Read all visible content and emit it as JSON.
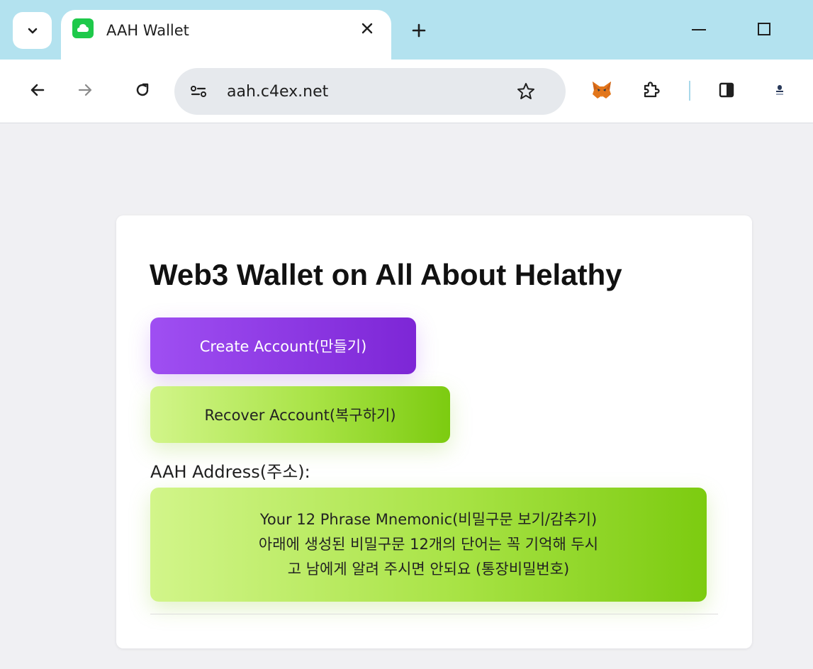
{
  "browser": {
    "tab": {
      "title": "AAH Wallet"
    },
    "address_bar": {
      "url": "aah.c4ex.net"
    },
    "icons": [
      "tab-search-icon",
      "favicon-icon",
      "close-icon",
      "plus-icon",
      "minimize-icon",
      "maximize-icon",
      "back-arrow-icon",
      "forward-arrow-icon",
      "reload-icon",
      "site-info-icon",
      "star-icon",
      "metamask-fox-icon",
      "extensions-puzzle-icon",
      "side-panel-icon",
      "profile-icon"
    ]
  },
  "page": {
    "title": "Web3 Wallet on All About Helathy",
    "create_button": "Create Account(만들기)",
    "recover_button": "Recover Account(복구하기)",
    "address_label": "AAH Address(주소):",
    "mnemonic_button": {
      "line1": "Your 12 Phrase Mnemonic(비밀구문 보기/감추기)",
      "line2": "아래에 생성된 비밀구문 12개의 단어는 꼭 기억해 두시",
      "line3": "고 남에게 알려 주시면 안되요 (통장비밀번호)"
    }
  },
  "colors": {
    "tabstrip": "#b3e2ef",
    "create_gradient": [
      "#9f4ff2",
      "#7d26d6"
    ],
    "recover_gradient": [
      "#d2f58a",
      "#7ccb10"
    ],
    "page_background": "#f0f0f3"
  }
}
